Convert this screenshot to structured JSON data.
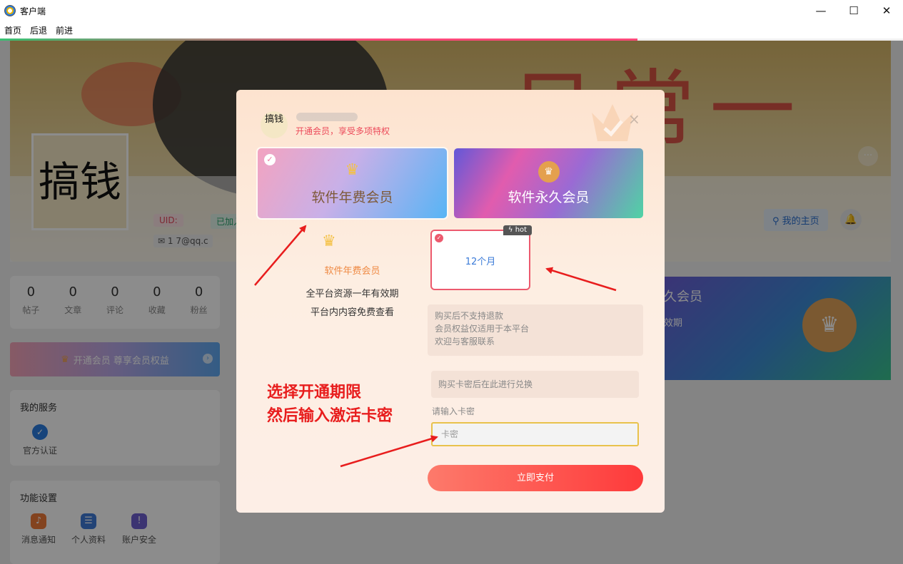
{
  "window": {
    "title": "客户端",
    "minimize": "—",
    "maximize": "☐",
    "close": "✕"
  },
  "menu": [
    "首页",
    "后退",
    "前进"
  ],
  "background": {
    "banner_text": "日常一日",
    "avatar_text": "搞钱",
    "uid_label": "UID: ",
    "joined_label": "已加入",
    "email": "1          7@qq.c",
    "home_button": "我的主页",
    "stats": [
      {
        "value": "0",
        "label": "帖子"
      },
      {
        "value": "0",
        "label": "文章"
      },
      {
        "value": "0",
        "label": "评论"
      },
      {
        "value": "0",
        "label": "收藏"
      },
      {
        "value": "0",
        "label": "粉丝"
      }
    ],
    "vip_bar": "开通会员 尊享会员权益",
    "services_title": "我的服务",
    "services": [
      {
        "label": "官方认证"
      }
    ],
    "settings_title": "功能设置",
    "settings": [
      {
        "label": "消息通知"
      },
      {
        "label": "个人资料"
      },
      {
        "label": "账户安全"
      }
    ],
    "right_vip_title": "久会员",
    "right_vip_sub": "效期"
  },
  "modal": {
    "avatar_text": "搞钱",
    "subtitle": "开通会员，享受多项特权",
    "close": "×",
    "plans": [
      {
        "label": "软件年费会员",
        "selected": true
      },
      {
        "label": "软件永久会员",
        "selected": false
      }
    ],
    "benefit_title": "软件年费会员",
    "benefits": [
      "全平台资源一年有效期",
      "平台内内容免费查看"
    ],
    "duration": {
      "label": "12个月",
      "tag": "hot",
      "selected": true
    },
    "notice": [
      "购买后不支持退款",
      "会员权益仅适用于本平台",
      "欢迎与客服联系"
    ],
    "redeem_hint": "购买卡密后在此进行兑换",
    "card_label": "请输入卡密",
    "card_placeholder": "卡密",
    "card_value": "",
    "pay_button": "立即支付"
  },
  "annotation": [
    "选择开通期限",
    "然后输入激活卡密"
  ],
  "colors": {
    "accent": "#fe3a3b",
    "annotation": "#e81d1d",
    "duration_border": "#ec5a6e",
    "link": "#3b7bd8"
  }
}
